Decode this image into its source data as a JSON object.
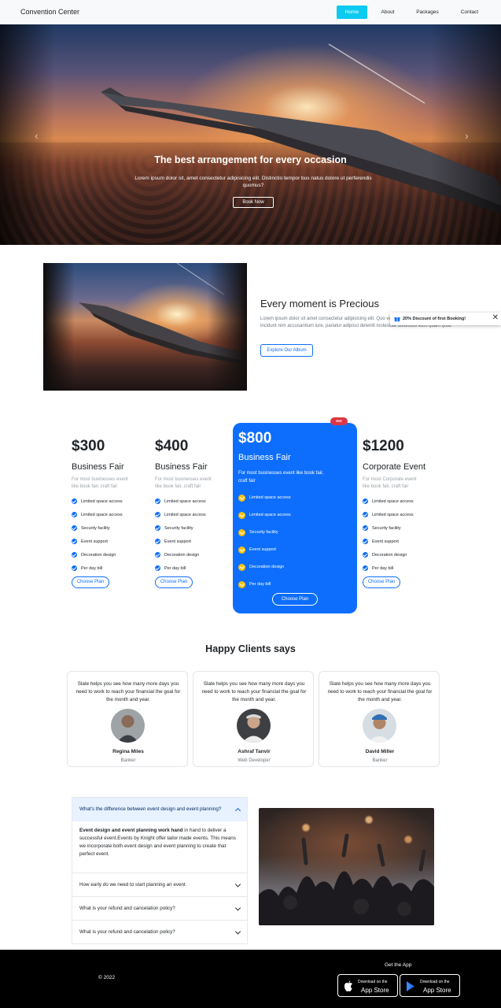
{
  "navbar": {
    "brand": "Convention Center",
    "links": [
      "Home",
      "About",
      "Packages",
      "Contact"
    ],
    "active": "Home"
  },
  "hero": {
    "title": "The best arrangement for every occasion",
    "text": "Lorem ipsum dolor sit, amet consectetur adipisicing elit. Distinctio tempor bus natus dolore ut perferendis quomus?",
    "button": "Book Now"
  },
  "about": {
    "title": "Every moment is Precious",
    "text": "Lorem ipsum dolor sit amet consectetur adipisicing elit. Quo vel tempore dolorem voluptatum nam incidunt rem accusantium iure, pariatur adipisci deleniti molestiae doloribus eum quam ipsa.",
    "button": "Explore Our Album"
  },
  "promo": {
    "text": "20% Discount of first Booking!",
    "close": "✕"
  },
  "pricing": {
    "plans": [
      {
        "price": "$300",
        "name": "Business Fair",
        "desc": "For most businesses event like book fair, craft fair",
        "features": [
          "Limited space access",
          "Limited space access",
          "Security facility",
          "Event support",
          "Decoration design",
          "Per day bill"
        ],
        "button": "Choose Plan"
      },
      {
        "price": "$400",
        "name": "Business Fair",
        "desc": "For most businesses event like book fair, craft fair",
        "features": [
          "Limited space access",
          "Limited space access",
          "Security facility",
          "Event support",
          "Decoration design",
          "Per day bill"
        ],
        "button": "Choose Plan"
      },
      {
        "price": "$800",
        "name": "Business Fair",
        "desc": "For most businesses event like book fair, craft fair",
        "badge": "Hot",
        "features": [
          "Limited space access",
          "Limited space access",
          "Security facility",
          "Event support",
          "Decoration design",
          "Per day bill"
        ],
        "button": "Choose Plan"
      },
      {
        "price": "$1200",
        "name": "Corporate Event",
        "desc": "For most Corporate event like book fair, craft fair",
        "features": [
          "Limited space access",
          "Limited space access",
          "Security facility",
          "Event support",
          "Decoration design",
          "Per day bill"
        ],
        "button": "Choose Plan"
      }
    ]
  },
  "testimonials": {
    "title": "Happy Clients says",
    "items": [
      {
        "quote": "Slate helps you see how many more days you need to work to reach your financial the goal for the month and year.",
        "name": "Regina Miles",
        "role": "Banker"
      },
      {
        "quote": "Slate helps you see how many more days you need to work to reach your financial the goal for the month and year.",
        "name": "Ashraf Tanvir",
        "role": "Web Developer"
      },
      {
        "quote": "Slate helps you see how many more days you need to work to reach your financial the goal for the month and year.",
        "name": "David Miller",
        "role": "Banker"
      }
    ]
  },
  "faq": {
    "items": [
      {
        "question": "What's the difference between event design and event planning?",
        "answer_bold": "Event design and event planning work hand",
        "answer_rest": " in hand to deliver a successful event.Events by Knight offer tailor made events. This means we incorporate both event design and event planning to create that perfect event."
      },
      {
        "question": "How early do we need to start planning an event"
      },
      {
        "question": "What is your refund and cancelation policy?"
      },
      {
        "question": "What is your refund and cancelation policy?"
      }
    ]
  },
  "footer": {
    "copyright": "© 2022",
    "get_app": "Get the App",
    "apple": {
      "small": "Download on the",
      "big": "App Store",
      "icon": "apple-icon"
    },
    "google": {
      "small": "Download on the",
      "big": "App Store",
      "icon": "google-play-icon"
    }
  },
  "colors": {
    "primary": "#0d6efd",
    "nav_active": "#0dcaf0",
    "hot_badge": "#dc3545",
    "check_featured": "#ffc107"
  }
}
